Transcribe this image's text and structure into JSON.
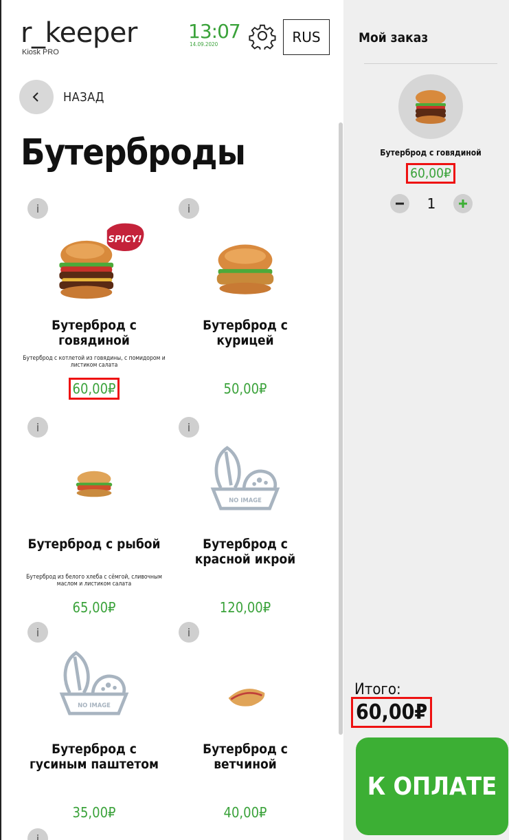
{
  "header": {
    "brand_name": "r_keeper",
    "brand_sub": "Kiosk PRO",
    "time": "13:07",
    "date": "14.09.2020",
    "language": "RUS",
    "icons": {
      "settings": "gear-icon",
      "back": "chevron-left-icon",
      "info": "info-icon"
    }
  },
  "nav": {
    "back_label": "НАЗАД"
  },
  "category": {
    "title": "Бутерброды"
  },
  "products": [
    {
      "name": "Бутерброд с говядиной",
      "description": "Бутерброд с котлетой из говядины, с помидором и листиком салата",
      "price": "60,00₽",
      "badge": "SPICY!",
      "image": "beef-burger",
      "highlighted": true
    },
    {
      "name": "Бутерброд с курицей",
      "description": "",
      "price": "50,00₽",
      "image": "chicken-burger",
      "highlighted": false
    },
    {
      "name": "Бутерброд с рыбой",
      "description": "Бутерброд из белого хлеба с сёмгой, сливочным маслом и листиком салата",
      "price": "65,00₽",
      "image": "fish-sandwich",
      "highlighted": false
    },
    {
      "name": "Бутерброд с красной икрой",
      "description": "",
      "price": "120,00₽",
      "image": "no-image",
      "no_image_label": "NO IMAGE",
      "highlighted": false
    },
    {
      "name": "Бутерброд с гусиным паштетом",
      "description": "",
      "price": "35,00₽",
      "image": "no-image",
      "no_image_label": "NO IMAGE",
      "highlighted": false
    },
    {
      "name": "Бутерброд с ветчиной",
      "description": "",
      "price": "40,00₽",
      "image": "ham-panini",
      "highlighted": false
    }
  ],
  "order": {
    "title": "Мой заказ",
    "item_name": "Бутерброд с говядиной",
    "item_price": "60,00₽",
    "quantity": "1",
    "total_label": "Итого:",
    "total_value": "60,00₽",
    "pay_label": "К ОПЛАТЕ"
  },
  "colors": {
    "accent_green": "#3caf34",
    "price_green": "#3aa23a",
    "highlight_red": "#e11111",
    "panel_gray": "#efefef"
  }
}
